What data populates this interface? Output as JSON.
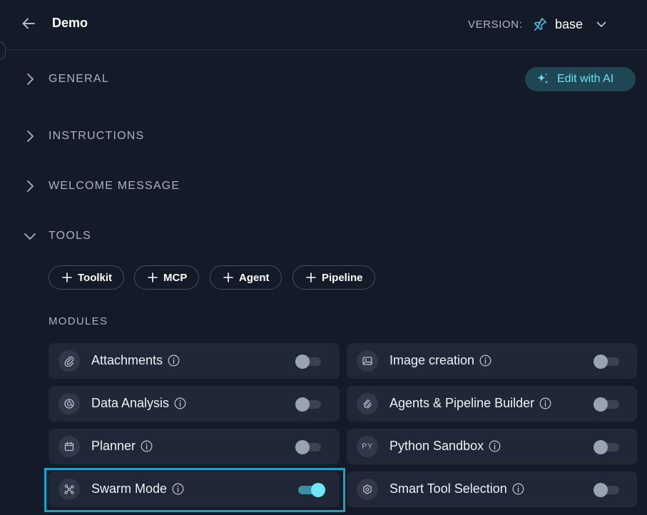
{
  "header": {
    "title": "Demo",
    "version_label": "VERSION:",
    "version_value": "base"
  },
  "sections": {
    "general": "GENERAL",
    "instructions": "INSTRUCTIONS",
    "welcome": "WELCOME MESSAGE",
    "tools": "TOOLS"
  },
  "edit_ai_label": "Edit with AI",
  "tool_chips": [
    "Toolkit",
    "MCP",
    "Agent",
    "Pipeline"
  ],
  "modules_title": "MODULES",
  "modules": [
    {
      "name": "Attachments",
      "icon": "paperclip-icon",
      "enabled": false
    },
    {
      "name": "Image creation",
      "icon": "image-icon",
      "enabled": false
    },
    {
      "name": "Data Analysis",
      "icon": "chart-icon",
      "enabled": false
    },
    {
      "name": "Agents & Pipeline Builder",
      "icon": "builder-icon",
      "enabled": false
    },
    {
      "name": "Planner",
      "icon": "calendar-icon",
      "enabled": false
    },
    {
      "name": "Python Sandbox",
      "icon": "python-icon",
      "icon_text": "PY",
      "enabled": false
    },
    {
      "name": "Swarm Mode",
      "icon": "swarm-icon",
      "enabled": true
    },
    {
      "name": "Smart Tool Selection",
      "icon": "hexagon-icon",
      "enabled": false
    }
  ],
  "colors": {
    "background": "#131a28",
    "card": "#202736",
    "accent": "#6fe7f7",
    "highlight": "#1aa3c4"
  }
}
